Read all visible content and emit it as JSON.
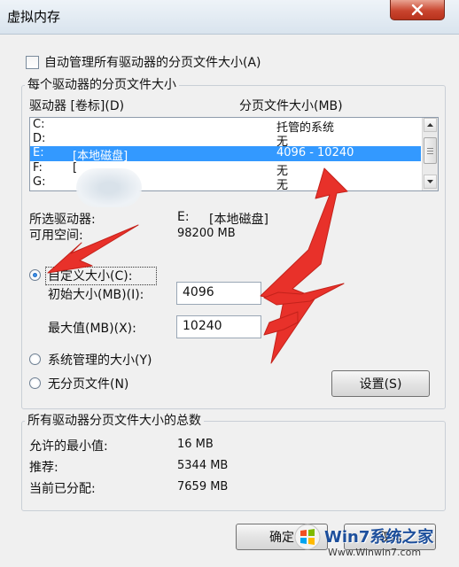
{
  "window": {
    "title": "虚拟内存"
  },
  "auto_manage": {
    "label": "自动管理所有驱动器的分页文件大小(A)",
    "checked": false
  },
  "drives_group": {
    "title": "每个驱动器的分页文件大小",
    "col_drive": "驱动器 [卷标](D)",
    "col_size": "分页文件大小(MB)",
    "rows": [
      {
        "drive": "C:",
        "label": "",
        "size": "托管的系统"
      },
      {
        "drive": "D:",
        "label": "",
        "size": "无"
      },
      {
        "drive": "E:",
        "label": "[本地磁盘]",
        "size": "4096 - 10240"
      },
      {
        "drive": "F:",
        "label": "[",
        "size": "无"
      },
      {
        "drive": "G:",
        "label": "]",
        "size": "无"
      }
    ],
    "selected_index": 2
  },
  "selected": {
    "drive_label": "所选驱动器:",
    "drive_value": "E:",
    "drive_vol": "[本地磁盘]",
    "space_label": "可用空间:",
    "space_value": "98200 MB"
  },
  "options": {
    "custom_label": "自定义大小(C):",
    "initial_label": "初始大小(MB)(I):",
    "initial_value": "4096",
    "max_label": "最大值(MB)(X):",
    "max_value": "10240",
    "system_label": "系统管理的大小(Y)",
    "none_label": "无分页文件(N)",
    "selected_option": "custom",
    "set_button": "设置(S)"
  },
  "total_group": {
    "title": "所有驱动器分页文件大小的总数",
    "min_label": "允许的最小值:",
    "min_value": "16 MB",
    "rec_label": "推荐:",
    "rec_value": "5344 MB",
    "cur_label": "当前已分配:",
    "cur_value": "7659 MB"
  },
  "footer": {
    "ok_button": "确定",
    "cancel_button": "取消"
  },
  "watermark": {
    "brand": "Win7系统之家",
    "url": "Www.Winwin7.com"
  },
  "colors": {
    "selection": "#3399ff",
    "annotation_arrow": "#e8312a",
    "close_button": "#c9452f"
  }
}
